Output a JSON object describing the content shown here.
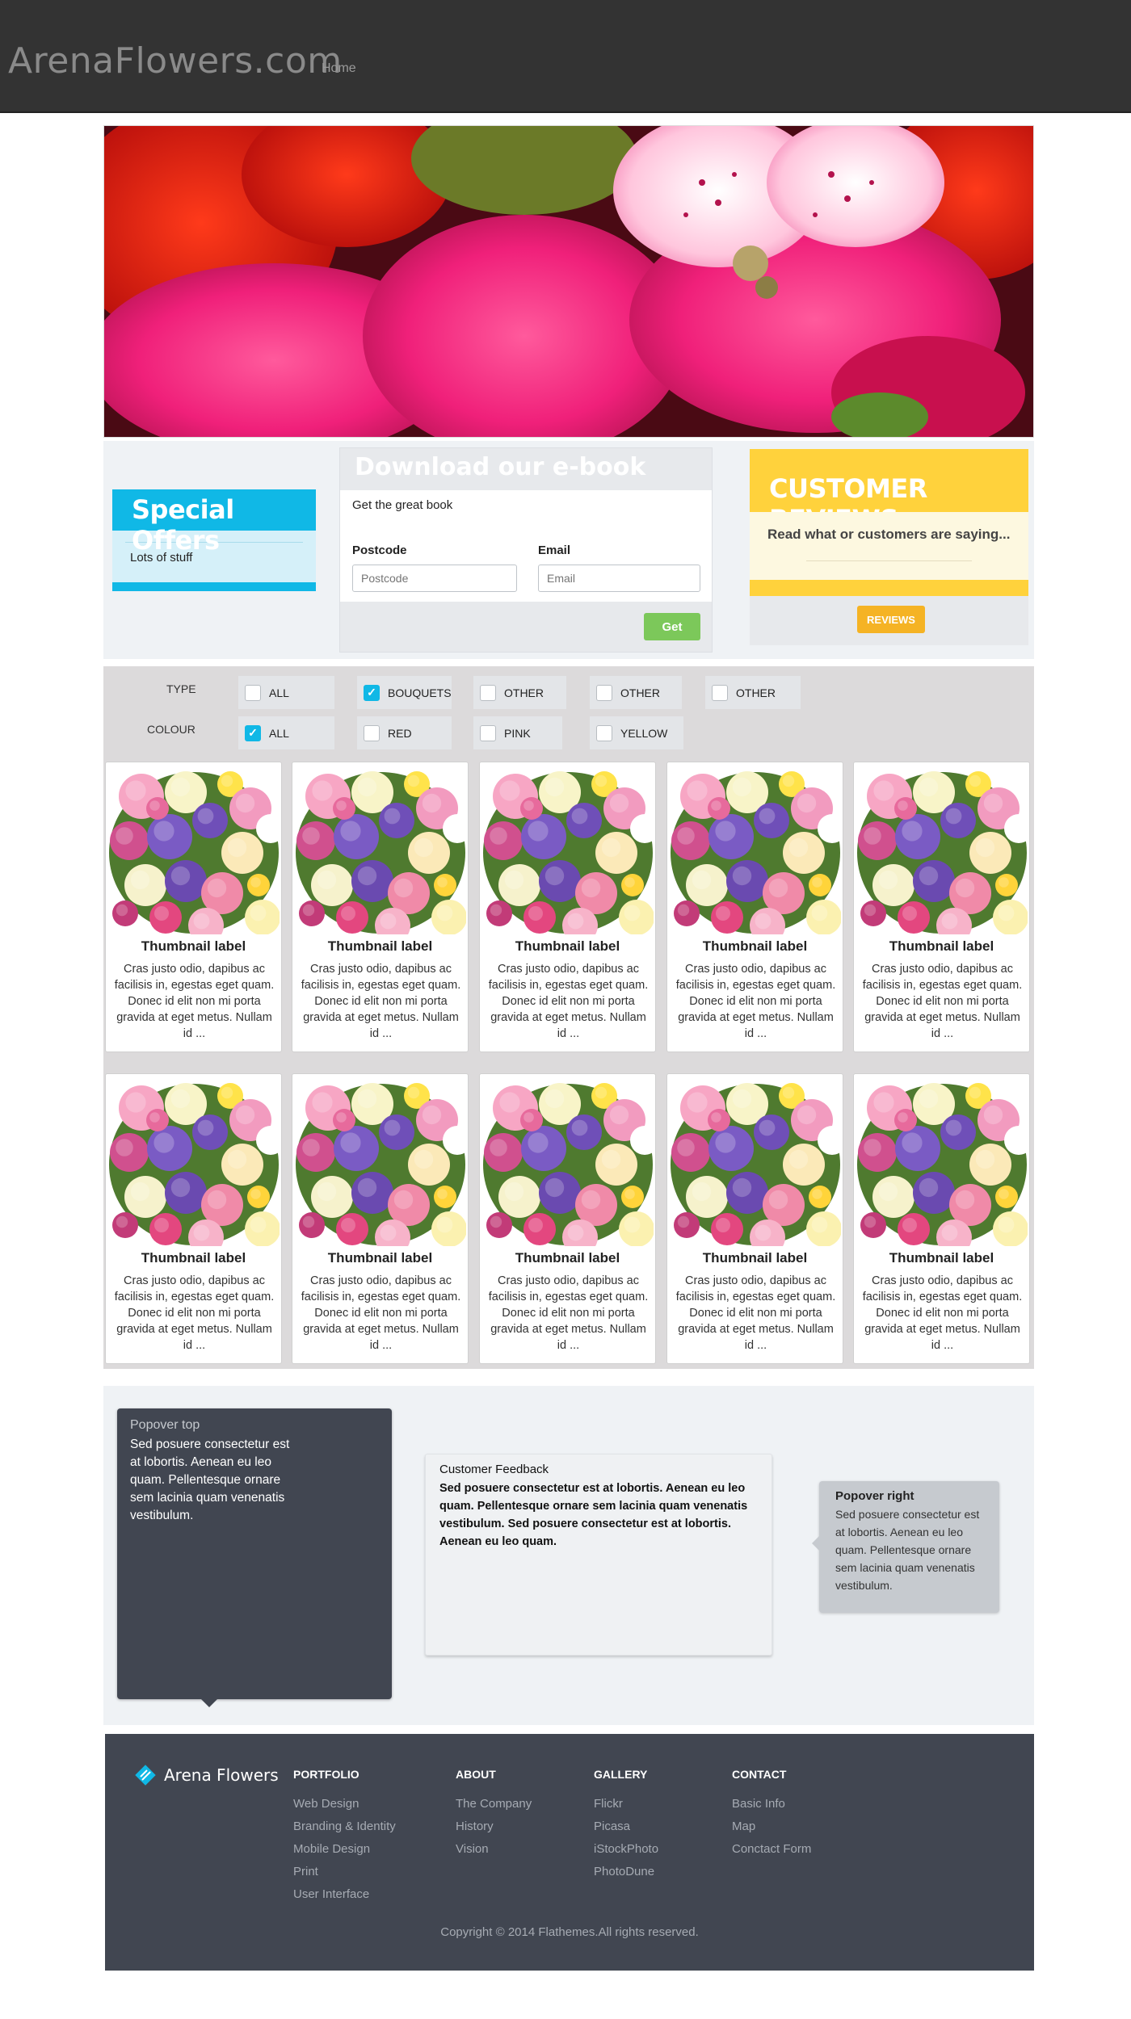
{
  "header": {
    "brand": "ArenaFlowers.com",
    "nav": [
      {
        "label": "Home"
      }
    ]
  },
  "promo": {
    "special_offers": {
      "title": "Special Offers",
      "body": "Lots of stuff"
    },
    "ebook": {
      "title": "Download our e-book",
      "subtitle": "Get the great book",
      "postcode_label": "Postcode",
      "postcode_placeholder": "Postcode",
      "email_label": "Email",
      "email_placeholder": "Email",
      "button": "Get"
    },
    "reviews": {
      "title": "CUSTOMER REVIEWS",
      "body": "Read what or customers are saying...",
      "button": "REVIEWS"
    }
  },
  "filters": {
    "type_label": "TYPE",
    "type_options": [
      {
        "label": "ALL",
        "checked": false
      },
      {
        "label": "BOUQUETS",
        "checked": true
      },
      {
        "label": "OTHER",
        "checked": false
      },
      {
        "label": "OTHER",
        "checked": false
      },
      {
        "label": "OTHER",
        "checked": false
      }
    ],
    "colour_label": "COLOUR",
    "colour_options": [
      {
        "label": "ALL",
        "checked": true
      },
      {
        "label": "RED",
        "checked": false
      },
      {
        "label": "PINK",
        "checked": false
      },
      {
        "label": "YELLOW",
        "checked": false
      }
    ]
  },
  "products": [
    {
      "title": "Thumbnail label",
      "text": "Cras justo odio, dapibus ac facilisis in, egestas eget quam. Donec id elit non mi porta gravida at eget metus. Nullam id ..."
    },
    {
      "title": "Thumbnail label",
      "text": "Cras justo odio, dapibus ac facilisis in, egestas eget quam. Donec id elit non mi porta gravida at eget metus. Nullam id ..."
    },
    {
      "title": "Thumbnail label",
      "text": "Cras justo odio, dapibus ac facilisis in, egestas eget quam. Donec id elit non mi porta gravida at eget metus. Nullam id ..."
    },
    {
      "title": "Thumbnail label",
      "text": "Cras justo odio, dapibus ac facilisis in, egestas eget quam. Donec id elit non mi porta gravida at eget metus. Nullam id ..."
    },
    {
      "title": "Thumbnail label",
      "text": "Cras justo odio, dapibus ac facilisis in, egestas eget quam. Donec id elit non mi porta gravida at eget metus. Nullam id ..."
    },
    {
      "title": "Thumbnail label",
      "text": "Cras justo odio, dapibus ac facilisis in, egestas eget quam. Donec id elit non mi porta gravida at eget metus. Nullam id ..."
    },
    {
      "title": "Thumbnail label",
      "text": "Cras justo odio, dapibus ac facilisis in, egestas eget quam. Donec id elit non mi porta gravida at eget metus. Nullam id ..."
    },
    {
      "title": "Thumbnail label",
      "text": "Cras justo odio, dapibus ac facilisis in, egestas eget quam. Donec id elit non mi porta gravida at eget metus. Nullam id ..."
    },
    {
      "title": "Thumbnail label",
      "text": "Cras justo odio, dapibus ac facilisis in, egestas eget quam. Donec id elit non mi porta gravida at eget metus. Nullam id ..."
    },
    {
      "title": "Thumbnail label",
      "text": "Cras justo odio, dapibus ac facilisis in, egestas eget quam. Donec id elit non mi porta gravida at eget metus. Nullam id ..."
    }
  ],
  "popovers": {
    "top": {
      "title": "Popover top",
      "body": "Sed posuere consectetur est at lobortis. Aenean eu leo quam. Pellentesque ornare sem lacinia quam venenatis vestibulum."
    },
    "feedback": {
      "title": "Customer Feedback",
      "body": "Sed posuere consectetur est at lobortis. Aenean eu leo quam. Pellentesque ornare sem lacinia quam venenatis vestibulum. Sed posuere consectetur est at lobortis. Aenean eu leo quam."
    },
    "right": {
      "title": "Popover right",
      "body": "Sed posuere consectetur est at lobortis. Aenean eu leo quam. Pellentesque ornare sem lacinia quam venenatis vestibulum."
    }
  },
  "footer": {
    "logo_text": "Arena Flowers",
    "columns": [
      {
        "heading": "PORTFOLIO",
        "links": [
          "Web Design",
          "Branding & Identity",
          "Mobile Design",
          "Print",
          "User Interface"
        ]
      },
      {
        "heading": "ABOUT",
        "links": [
          "The Company",
          "History",
          "Vision"
        ]
      },
      {
        "heading": "GALLERY",
        "links": [
          "Flickr",
          "Picasa",
          "iStockPhoto",
          "PhotoDune"
        ]
      },
      {
        "heading": "CONTACT",
        "links": [
          "Basic Info",
          "Map",
          "Conctact Form"
        ]
      }
    ],
    "copyright": "Copyright © 2014 Flathemes.All rights reserved."
  },
  "colors": {
    "accent_cyan": "#10b8e6",
    "accent_yellow": "#ffd23c",
    "accent_green": "#7cc85a",
    "dark": "#414651"
  }
}
